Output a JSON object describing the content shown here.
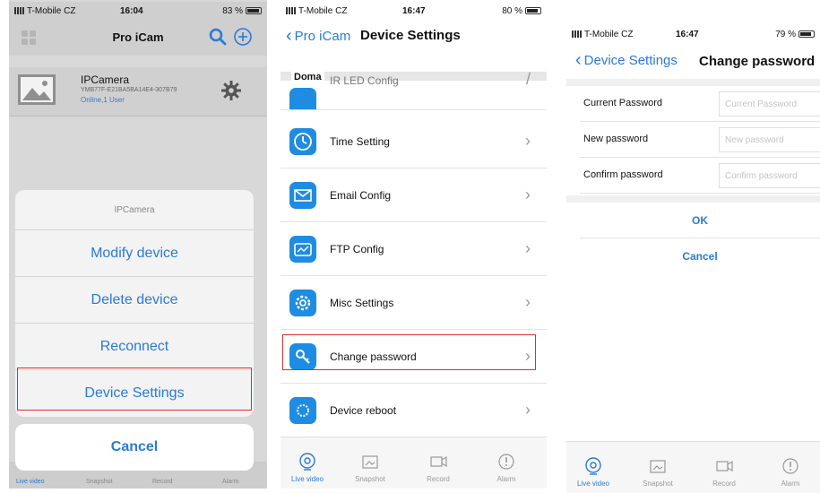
{
  "phone1": {
    "status": {
      "carrier": "T-Mobile CZ",
      "time": "16:04",
      "battery": "83 %",
      "battery_level": 0.83
    },
    "nav_title": "Pro iCam",
    "camera": {
      "name": "IPCamera",
      "id": "YMB77F-E21BA5BA14E4-307B79",
      "status": "Online,1 User"
    },
    "sheet": {
      "title": "IPCamera",
      "items": [
        "Modify device",
        "Delete device",
        "Reconnect",
        "Device Settings"
      ],
      "cancel": "Cancel"
    },
    "tabs": [
      "Live video",
      "Snapshot",
      "Record",
      "Alarm"
    ]
  },
  "phone2": {
    "status": {
      "carrier": "T-Mobile CZ",
      "time": "16:47",
      "battery": "80 %",
      "battery_level": 0.8
    },
    "back_label": "Pro iCam",
    "nav_title": "Device Settings",
    "section": "Doma",
    "partial_row": "IR LED Config",
    "rows": [
      "Time Setting",
      "Email Config",
      "FTP Config",
      "Misc Settings",
      "Change password",
      "Device reboot"
    ],
    "tabs": [
      "Live video",
      "Snapshot",
      "Record",
      "Alarm"
    ]
  },
  "phone3": {
    "status": {
      "carrier": "T-Mobile CZ",
      "time": "16:47",
      "battery": "79 %",
      "battery_level": 0.79
    },
    "back_label": "Device Settings",
    "nav_title": "Change password",
    "fields": [
      {
        "label": "Current Password",
        "placeholder": "Current Password",
        "value": ""
      },
      {
        "label": "New password",
        "placeholder": "New password",
        "value": ""
      },
      {
        "label": "Confirm password",
        "placeholder": "Confirm password",
        "value": ""
      }
    ],
    "ok_label": "OK",
    "cancel_label": "Cancel",
    "tabs": [
      "Live video",
      "Snapshot",
      "Record",
      "Alarm"
    ]
  },
  "colors": {
    "accent": "#2b7ad8",
    "highlight": "#d9302b",
    "icon_bg": "#1e8ce3"
  }
}
